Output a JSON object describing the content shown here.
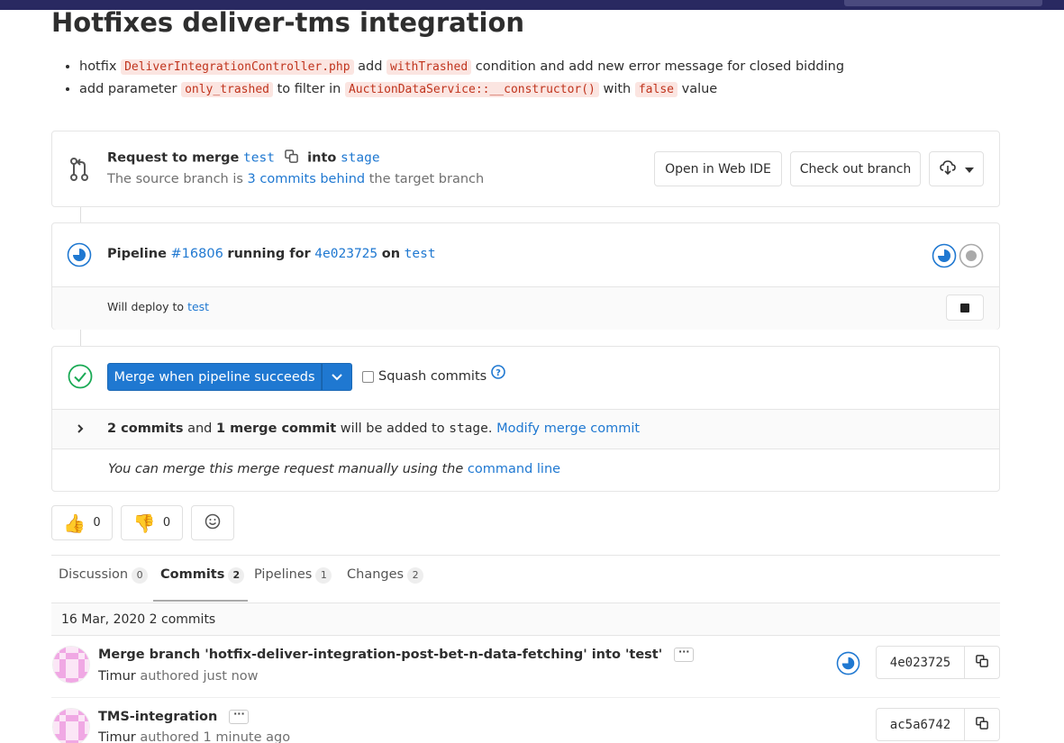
{
  "title": "Hotfixes deliver-tms integration",
  "description": {
    "line1": {
      "prefix": "hotfix",
      "code1": "DeliverIntegrationController.php",
      "mid": "add",
      "code2": "withTrashed",
      "suffix": "condition and add new error message for closed bidding"
    },
    "line2": {
      "prefix": "add parameter",
      "code1": "only_trashed",
      "mid1": "to filter in",
      "code2": "AuctionDataService::__constructor()",
      "mid2": "with",
      "code3": "false",
      "suffix": "value"
    }
  },
  "merge_request": {
    "request_label": "Request to merge",
    "source_branch": "test",
    "into_label": "into",
    "target_branch": "stage",
    "behind_prefix": "The source branch is",
    "behind_link": "3 commits behind",
    "behind_suffix": "the target branch",
    "open_web_ide": "Open in Web IDE",
    "check_out_branch": "Check out branch"
  },
  "pipeline": {
    "label": "Pipeline",
    "id": "#16806",
    "running_for": "running for",
    "sha": "4e023725",
    "on_label": "on",
    "branch": "test",
    "deploy_text": "Will deploy to",
    "deploy_env": "test"
  },
  "merge_widget": {
    "merge_button": "Merge when pipeline succeeds",
    "squash_label": "Squash commits",
    "squash_checked": false,
    "commits_count": "2 commits",
    "and_label": "and",
    "merge_commit_count": "1 merge commit",
    "will_be_added": "will be added to",
    "target": "stage",
    "modify_link": "Modify merge commit",
    "manual_text": "You can merge this merge request manually using the",
    "command_line_link": "command line"
  },
  "reactions": {
    "thumbs_up": "0",
    "thumbs_down": "0"
  },
  "tabs": [
    {
      "label": "Discussion",
      "count": "0"
    },
    {
      "label": "Commits",
      "count": "2",
      "active": true
    },
    {
      "label": "Pipelines",
      "count": "1"
    },
    {
      "label": "Changes",
      "count": "2"
    }
  ],
  "commits": {
    "date_header": "16 Mar, 2020 2 commits",
    "items": [
      {
        "title": "Merge branch 'hotfix-deliver-integration-post-bet-n-data-fetching' into 'test'",
        "author": "Timur",
        "authored": "authored just now",
        "sha": "4e023725"
      },
      {
        "title": "TMS-integration",
        "author": "Timur",
        "authored": "authored 1 minute ago",
        "sha": "ac5a6742"
      }
    ]
  },
  "colors": {
    "accent": "#1f78d1",
    "topbar": "#292961",
    "success": "#1aaa55",
    "code_bg": "#fbe5e1",
    "code_fg": "#c0341d"
  }
}
